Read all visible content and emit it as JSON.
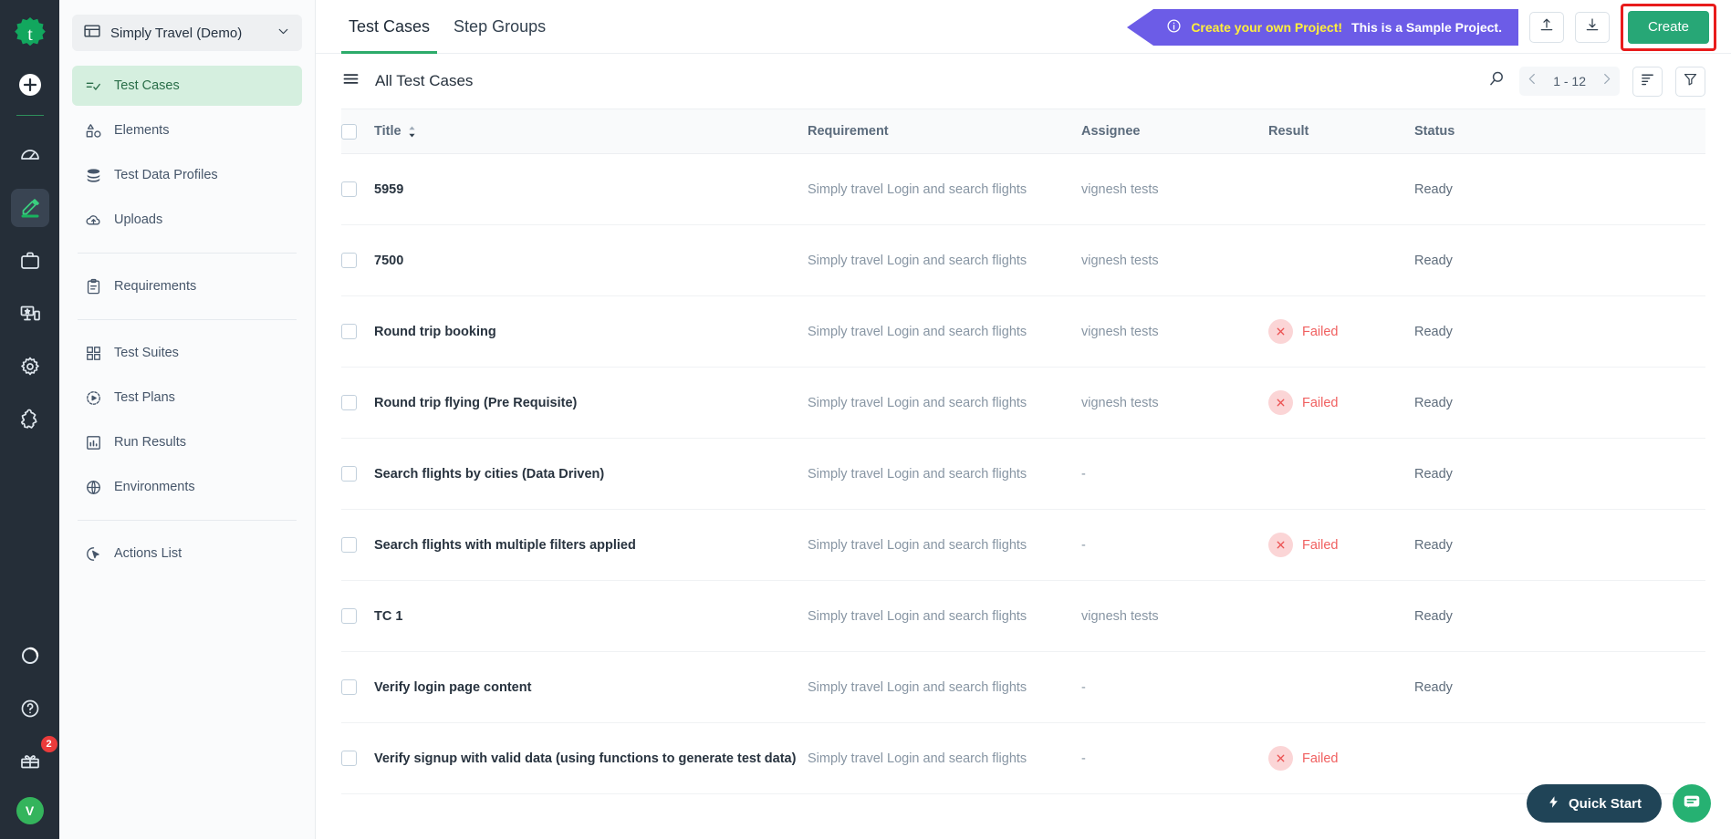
{
  "rail": {
    "logo": "testsigma-logo",
    "add_label": "+",
    "items": [
      {
        "name": "dashboard",
        "icon": "speedometer-icon",
        "active": false
      },
      {
        "name": "test-development",
        "icon": "pencil-icon",
        "active": true
      },
      {
        "name": "projects",
        "icon": "briefcase-icon",
        "active": false
      },
      {
        "name": "test-lab",
        "icon": "devices-icon",
        "active": false
      },
      {
        "name": "settings",
        "icon": "gear-icon",
        "active": false
      },
      {
        "name": "addons",
        "icon": "puzzle-icon",
        "active": false
      }
    ],
    "bottom": [
      {
        "name": "progress",
        "icon": "circular-progress-icon"
      },
      {
        "name": "help",
        "icon": "question-circle-icon"
      },
      {
        "name": "gifts",
        "icon": "gift-icon",
        "badge": "2"
      }
    ],
    "avatar_initial": "V"
  },
  "sidebar": {
    "project": {
      "icon": "project-icon",
      "name": "Simply Travel (Demo)",
      "chevron": "chevron-down-icon"
    },
    "groups": [
      {
        "items": [
          {
            "label": "Test Cases",
            "icon": "test-cases-icon",
            "active": true
          },
          {
            "label": "Elements",
            "icon": "elements-icon",
            "active": false
          },
          {
            "label": "Test Data Profiles",
            "icon": "database-icon",
            "active": false
          },
          {
            "label": "Uploads",
            "icon": "cloud-upload-icon",
            "active": false
          }
        ]
      },
      {
        "items": [
          {
            "label": "Requirements",
            "icon": "clipboard-icon",
            "active": false
          }
        ]
      },
      {
        "items": [
          {
            "label": "Test Suites",
            "icon": "grid-icon",
            "active": false
          },
          {
            "label": "Test Plans",
            "icon": "play-circle-icon",
            "active": false
          },
          {
            "label": "Run Results",
            "icon": "bar-chart-icon",
            "active": false
          },
          {
            "label": "Environments",
            "icon": "globe-icon",
            "active": false
          }
        ]
      },
      {
        "items": [
          {
            "label": "Actions List",
            "icon": "cursor-click-icon",
            "active": false
          }
        ]
      }
    ]
  },
  "topbar": {
    "tabs": [
      {
        "label": "Test Cases",
        "active": true
      },
      {
        "label": "Step Groups",
        "active": false
      }
    ],
    "banner": {
      "icon": "info-icon",
      "highlight": "Create your own Project!",
      "text": "This is a Sample Project."
    },
    "upload_icon": "upload-icon",
    "download_icon": "download-icon",
    "create_label": "Create",
    "highlight_color": "#e81c1c",
    "create_color": "#27a776",
    "banner_color": "#6c5ce7",
    "banner_highlight_color": "#ffef3c"
  },
  "list": {
    "menu_icon": "hamburger-icon",
    "title": "All Test Cases",
    "search_icon": "search-icon",
    "prev_icon": "chevron-left-icon",
    "next_icon": "chevron-right-icon",
    "page_range": "1 - 12",
    "sort_icon": "sort-icon",
    "filter_icon": "filter-icon"
  },
  "table": {
    "columns": [
      "Title",
      "Requirement",
      "Assignee",
      "Result",
      "Status"
    ],
    "sort_indicator": "sort-arrows-icon",
    "rows": [
      {
        "title": "5959",
        "requirement": "Simply travel Login and search flights",
        "assignee": "vignesh tests",
        "result": "",
        "status": "Ready"
      },
      {
        "title": "7500",
        "requirement": "Simply travel Login and search flights",
        "assignee": "vignesh tests",
        "result": "",
        "status": "Ready"
      },
      {
        "title": "Round trip booking",
        "requirement": "Simply travel Login and search flights",
        "assignee": "vignesh tests",
        "result": "Failed",
        "status": "Ready"
      },
      {
        "title": "Round trip flying (Pre Requisite)",
        "requirement": "Simply travel Login and search flights",
        "assignee": "vignesh tests",
        "result": "Failed",
        "status": "Ready"
      },
      {
        "title": "Search flights by cities (Data Driven)",
        "requirement": "Simply travel Login and search flights",
        "assignee": "-",
        "result": "",
        "status": "Ready"
      },
      {
        "title": "Search flights with multiple filters applied",
        "requirement": "Simply travel Login and search flights",
        "assignee": "-",
        "result": "Failed",
        "status": "Ready"
      },
      {
        "title": "TC 1",
        "requirement": "Simply travel Login and search flights",
        "assignee": "vignesh tests",
        "result": "",
        "status": "Ready"
      },
      {
        "title": "Verify login page content",
        "requirement": "Simply travel Login and search flights",
        "assignee": "-",
        "result": "",
        "status": "Ready"
      },
      {
        "title": "Verify signup with valid data (using functions to generate test data)",
        "requirement": "Simply travel Login and search flights",
        "assignee": "-",
        "result": "Failed",
        "status": ""
      }
    ],
    "failed_color": "#f06060"
  },
  "floaters": {
    "quick_start_label": "Quick Start",
    "quick_start_icon": "lightning-icon",
    "chat_icon": "chat-icon"
  }
}
